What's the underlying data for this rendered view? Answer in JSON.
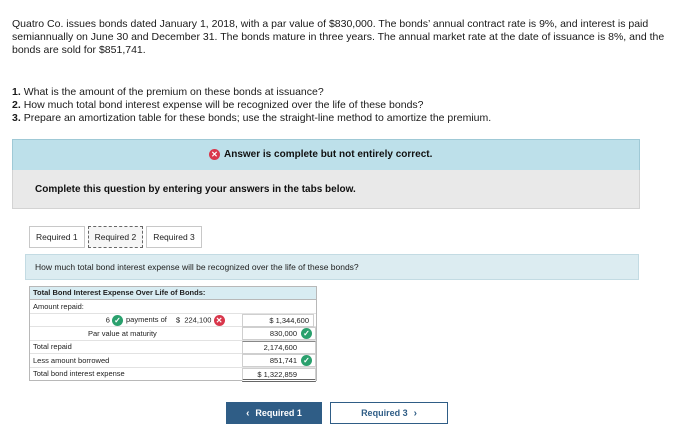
{
  "problem_text": "Quatro Co. issues bonds dated January 1, 2018, with a par value of $830,000. The bonds’ annual contract rate is 9%, and interest is paid semiannually on June 30 and December 31. The bonds mature in three years. The annual market rate at the date of issuance is 8%, and the bonds are sold for $851,741.",
  "questions": [
    {
      "num": "1.",
      "text": "What is the amount of the premium on these bonds at issuance?"
    },
    {
      "num": "2.",
      "text": "How much total bond interest expense will be recognized over the life of these bonds?"
    },
    {
      "num": "3.",
      "text": "Prepare an amortization table for these bonds; use the straight-line method to amortize the premium."
    }
  ],
  "answer_status": "Answer is complete but not entirely correct.",
  "complete_instruction": "Complete this question by entering your answers in the tabs below.",
  "tabs": [
    "Required 1",
    "Required 2",
    "Required 3"
  ],
  "prompt": "How much total bond interest expense will be recognized over the life of these bonds?",
  "table": {
    "header": "Total Bond Interest Expense Over Life of Bonds:",
    "amount_repaid_label": "Amount repaid:",
    "payments_count": "6",
    "payments_label": "payments of",
    "payment_currency": "$",
    "payment_amount": "224,100",
    "payments_total": "$ 1,344,600",
    "par_label": "Par value at maturity",
    "par_value": "830,000",
    "total_repaid_label": "Total repaid",
    "total_repaid": "2,174,600",
    "less_borrowed_label": "Less amount borrowed",
    "less_borrowed": "851,741",
    "total_interest_label": "Total bond interest expense",
    "total_interest": "$ 1,322,859"
  },
  "buttons": {
    "prev": "Required 1",
    "next": "Required 3"
  },
  "colors": {
    "correct": "#2aa06d",
    "incorrect": "#d9364b",
    "button": "#2f5d86"
  }
}
